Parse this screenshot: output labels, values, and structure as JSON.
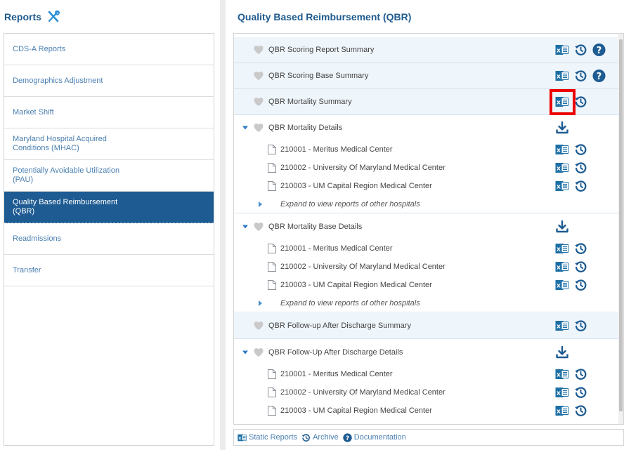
{
  "sidebar": {
    "title": "Reports",
    "items": [
      {
        "label": "CDS-A Reports"
      },
      {
        "label": "Demographics Adjustment"
      },
      {
        "label": "Market Shift"
      },
      {
        "label": "Maryland Hospital Acquired Conditions (MHAC)"
      },
      {
        "label": "Potentially Avoidable Utilization (PAU)"
      },
      {
        "label": "Quality Based Reimbursement (QBR)"
      },
      {
        "label": "Readmissions"
      },
      {
        "label": "Transfer"
      }
    ]
  },
  "main": {
    "title": "Quality Based Reimbursement (QBR)",
    "rows": [
      {
        "label": "QBR Scoring Report Summary"
      },
      {
        "label": "QBR Scoring Base Summary"
      },
      {
        "label": "QBR Mortality Summary"
      },
      {
        "label": "QBR Mortality Details"
      },
      {
        "label": "210001 - Meritus Medical Center"
      },
      {
        "label": "210002 - University Of Maryland Medical Center"
      },
      {
        "label": "210003 - UM Capital Region Medical Center"
      },
      {
        "label": "Expand to view reports of other hospitals"
      },
      {
        "label": "QBR Mortality Base Details"
      },
      {
        "label": "210001 - Meritus Medical Center"
      },
      {
        "label": "210002 - University Of Maryland Medical Center"
      },
      {
        "label": "210003 - UM Capital Region Medical Center"
      },
      {
        "label": "Expand to view reports of other hospitals"
      },
      {
        "label": "QBR Follow-up After Discharge Summary"
      },
      {
        "label": "QBR Follow-Up After Discharge Details"
      },
      {
        "label": "210001 - Meritus Medical Center"
      },
      {
        "label": "210002 - University Of Maryland Medical Center"
      },
      {
        "label": "210003 - UM Capital Region Medical Center"
      }
    ]
  },
  "footer": {
    "static_reports": "Static Reports",
    "archive": "Archive",
    "documentation": "Documentation"
  },
  "colors": {
    "accent": "#1d5b92",
    "link": "#4a7fb0",
    "excel": "#1d6fa5",
    "highlight": "#ee0000"
  }
}
